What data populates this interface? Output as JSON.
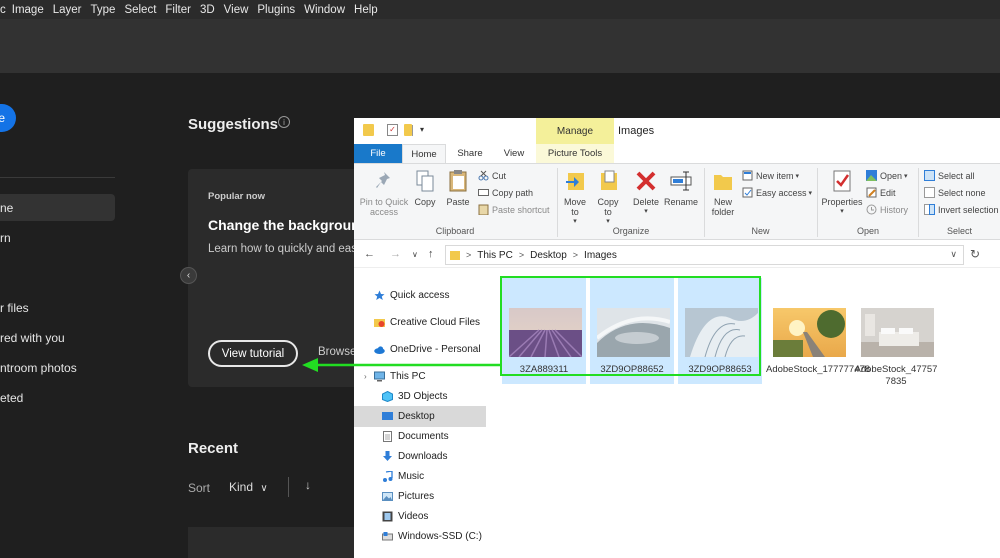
{
  "ps_menu": [
    "Image",
    "Layer",
    "Type",
    "Select",
    "Filter",
    "3D",
    "View",
    "Plugins",
    "Window",
    "Help"
  ],
  "ps_sidebar": {
    "new_button": "e",
    "items": [
      "ne",
      "rn",
      "r files",
      "red with you",
      "ntroom photos",
      "eted"
    ]
  },
  "suggestions": {
    "title": "Suggestions",
    "info_glyph": "i",
    "popular": "Popular now",
    "card_title": "Change the background",
    "card_desc": "Learn how to quickly and easily",
    "view_tutorial": "View tutorial",
    "browse": "Browse",
    "prev_glyph": "‹"
  },
  "recent": {
    "title": "Recent",
    "sort_label": "Sort",
    "kind": "Kind",
    "kind_glyph": "∨",
    "direction_glyph": "↓"
  },
  "explorer": {
    "title": "Images",
    "manage_tab": "Manage",
    "tabs": {
      "file": "File",
      "home": "Home",
      "share": "Share",
      "view": "View",
      "picture_tools": "Picture Tools"
    },
    "ribbon": {
      "clipboard": {
        "pin": "Pin to Quick access",
        "copy": "Copy",
        "paste": "Paste",
        "cut": "Cut",
        "copy_path": "Copy path",
        "paste_shortcut": "Paste shortcut",
        "label": "Clipboard"
      },
      "organize": {
        "move_to": "Move to",
        "copy_to": "Copy to",
        "delete": "Delete",
        "rename": "Rename",
        "label": "Organize"
      },
      "new": {
        "new_folder": "New folder",
        "new_item": "New item",
        "easy_access": "Easy access",
        "label": "New"
      },
      "open": {
        "properties": "Properties",
        "open": "Open",
        "edit": "Edit",
        "history": "History",
        "label": "Open"
      },
      "select": {
        "select_all": "Select all",
        "select_none": "Select none",
        "invert": "Invert selection",
        "label": "Select"
      }
    },
    "address": {
      "parts": [
        "This PC",
        "Desktop",
        "Images"
      ]
    },
    "nav_glyphs": {
      "back": "←",
      "forward": "→",
      "recent": "∨",
      "up": "↑",
      "refresh": "↻",
      "chevron": ">",
      "dropdown": "∨",
      "expand": "›"
    },
    "nav": [
      "Quick access",
      "Creative Cloud Files",
      "OneDrive - Personal",
      "This PC",
      "3D Objects",
      "Desktop",
      "Documents",
      "Downloads",
      "Music",
      "Pictures",
      "Videos",
      "Windows-SSD (C:)"
    ],
    "files": [
      {
        "name": "3ZA889311",
        "selected": true
      },
      {
        "name": "3ZD9OP88652",
        "selected": true
      },
      {
        "name": "3ZD9OP88653",
        "selected": true
      },
      {
        "name": "AdobeStock_177777478",
        "selected": false
      },
      {
        "name": "AdobeStock_477577835",
        "selected": false
      }
    ]
  },
  "colors": {
    "highlight": "#22dd22",
    "accent": "#1473e6",
    "file_tab": "#1979ca",
    "manage": "#f4f09a"
  }
}
